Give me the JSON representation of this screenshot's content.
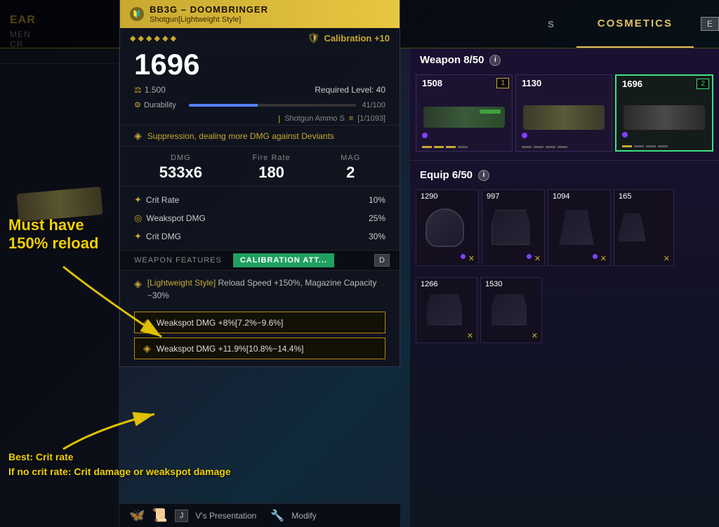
{
  "topBar": {
    "leftTabs": [
      "EAR",
      "MEN",
      "CR"
    ],
    "cosmetics_label": "COSMETICS",
    "key_e": "E"
  },
  "weaponPanel": {
    "headerName": "BB3G – DOOMBRINGER",
    "subtype": "Shotgun[Lightweight Style]",
    "stars": [
      "◆",
      "◆",
      "◆",
      "◆",
      "◆",
      "◆"
    ],
    "calibration": "Calibration +10",
    "powerLevel": "1696",
    "weight": "1.500",
    "requiredLevel": "Required Level: 40",
    "durabilityLabel": "Durability",
    "durabilityValue": "41/100",
    "ammoType": "Shotgun Ammo S",
    "ammoCount": "[1/1093]",
    "perk": "Suppression, dealing more DMG against Deviants",
    "dmgLabel": "DMG",
    "dmgValue": "533x6",
    "fireRateLabel": "Fire Rate",
    "fireRateValue": "180",
    "magLabel": "MAG",
    "magValue": "2",
    "detailStats": [
      {
        "icon": "✦",
        "label": "Crit Rate",
        "value": "10%"
      },
      {
        "icon": "◎",
        "label": "Weakspot DMG",
        "value": "25%"
      },
      {
        "icon": "✦",
        "label": "Crit DMG",
        "value": "30%"
      }
    ],
    "featureTabInactive": "WEAPON FEATURES",
    "featureTabActive": "CALIBRATION ATT...",
    "featureTabKey": "D",
    "perkDetail": "[Lightweight Style] Reload Speed +150%, Magazine Capacity −30%",
    "weakspotBoxes": [
      "Weakspot DMG +8%[7.2%−9.6%]",
      "Weakspot DMG +11.9%[10.8%−14.4%]"
    ],
    "bottomKey1": "J",
    "bottomLabel1": "V's Presentation",
    "bottomKey2": "◎",
    "bottomLabel2": "Modify"
  },
  "annotations": {
    "topText1": "Must have",
    "topText2": "150% reload",
    "bottomText1": "Best: Crit rate",
    "bottomText2": "If no crit rate: Crit damage or weakspot damage"
  },
  "rightPanel": {
    "weaponSection": "Weapon 8/50",
    "weapons": [
      {
        "power": "1508",
        "slot": "1"
      },
      {
        "power": "1130",
        "slot": ""
      },
      {
        "power": "1696",
        "slot": "2",
        "selected": true
      }
    ],
    "equipSection": "Equip 6/50",
    "equipItems": [
      {
        "power": "1290"
      },
      {
        "power": "997"
      },
      {
        "power": "1094"
      },
      {
        "power": "165"
      }
    ],
    "bottomItems": [
      {
        "power": "1266"
      },
      {
        "power": "1530"
      }
    ]
  }
}
